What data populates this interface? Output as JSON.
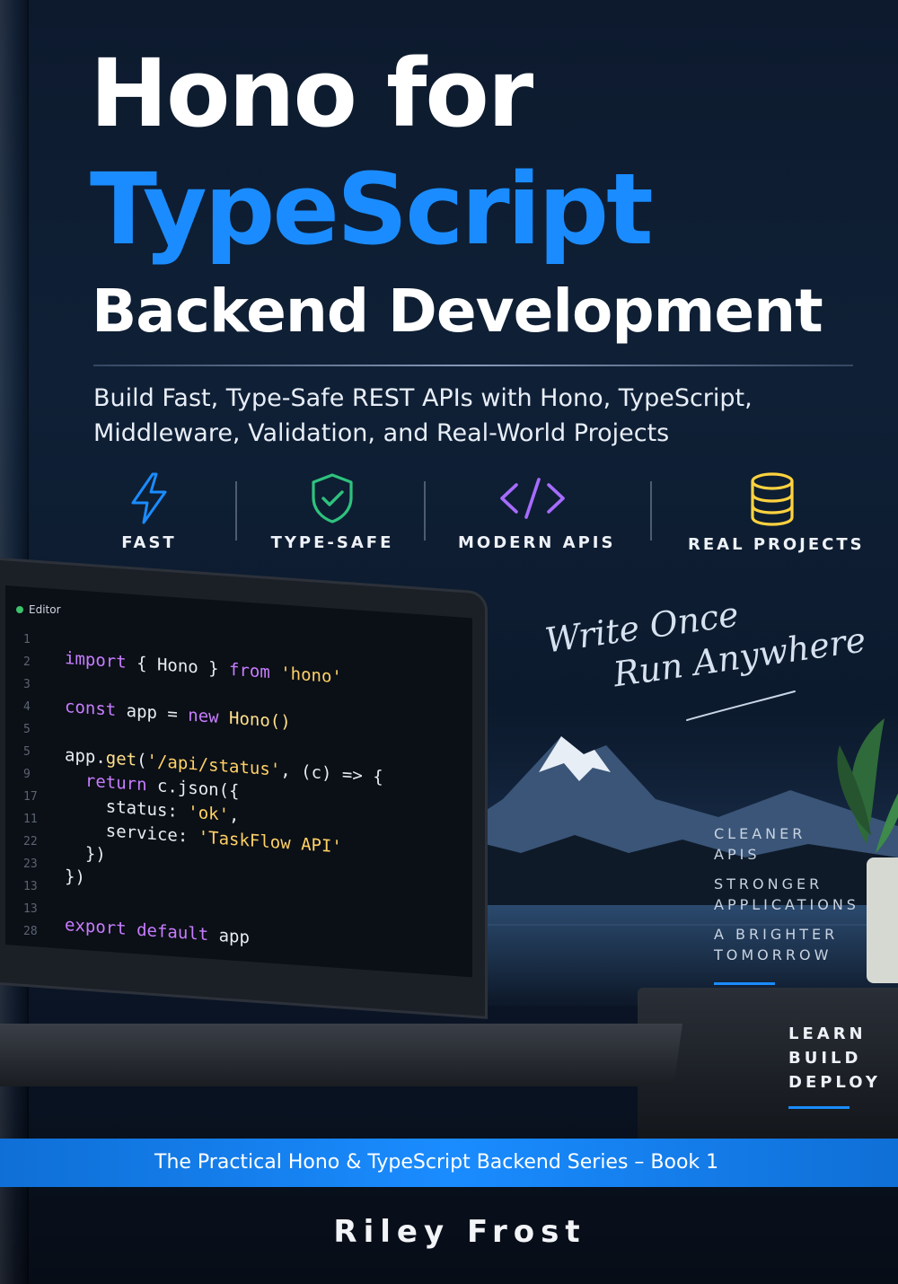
{
  "cover": {
    "title_line1": "Hono for",
    "title_line2": "TypeScript",
    "title_line3": "Backend Development",
    "subtitle_line1": "Build Fast, Type-Safe REST APIs with Hono, TypeScript,",
    "subtitle_line2": "Middleware, Validation, and Real-World Projects",
    "accent_color": "#1a8cff"
  },
  "features": [
    {
      "label": "FAST",
      "icon": "lightning-bolt-icon",
      "color": "#1a8cff"
    },
    {
      "label": "TYPE-SAFE",
      "icon": "shield-check-icon",
      "color": "#2ec27e"
    },
    {
      "label": "MODERN APIS",
      "icon": "code-brackets-icon",
      "color": "#a66cff"
    },
    {
      "label": "REAL PROJECTS",
      "icon": "database-icon",
      "color": "#ffd23f"
    }
  ],
  "editor": {
    "tab_label": "Editor",
    "line_numbers": [
      "1",
      "2",
      "3",
      "4",
      "5",
      "5",
      "9",
      "17",
      "11",
      "22",
      "23",
      "13",
      "13",
      "28"
    ],
    "code": {
      "l1_kw": "import",
      "l1_rest": " { Hono } ",
      "l1_kw2": "from",
      "l1_str": " 'hono'",
      "l2_kw": "const",
      "l2_rest": " app = ",
      "l2_kw2": "new",
      "l2_fn": " Hono()",
      "l3_pre": "app.",
      "l3_fn": "get",
      "l3_open": "(",
      "l3_str": "'/api/status'",
      "l3_rest": ", (c) => {",
      "l4_kw": "  return",
      "l4_rest": " c.json({",
      "l5_key": "    status: ",
      "l5_str": "'ok'",
      "l5_end": ",",
      "l6_key": "    service: ",
      "l6_str": "'TaskFlow API'",
      "l7": "  })",
      "l8": "})",
      "l9_kw": "export default",
      "l9_rest": " app"
    }
  },
  "tagline": {
    "line1": "Write Once",
    "line2": "Run Anywhere"
  },
  "side_list": [
    "CLEANER",
    "APIS",
    "STRONGER",
    "APPLICATIONS",
    "A BRIGHTER",
    "TOMORROW"
  ],
  "verbs": [
    "LEARN",
    "BUILD",
    "DEPLOY"
  ],
  "series": "The Practical Hono & TypeScript Backend Series – Book 1",
  "author": "Riley Frost"
}
